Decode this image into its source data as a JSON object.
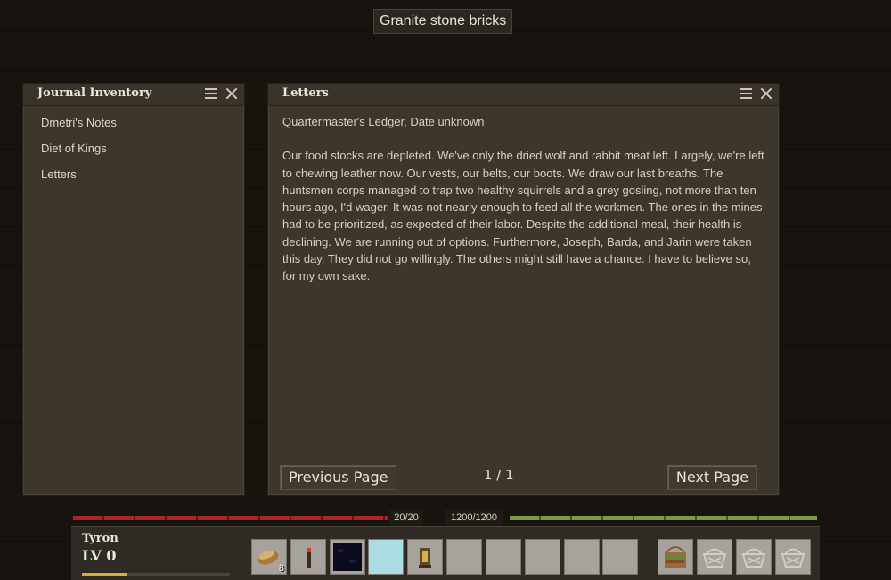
{
  "tooltip": "Granite stone bricks",
  "journal_panel": {
    "title": "Journal Inventory",
    "items": [
      "Dmetri's Notes",
      "Diet of Kings",
      "Letters"
    ]
  },
  "letters_panel": {
    "title": "Letters",
    "heading": "Quartermaster's Ledger, Date unknown",
    "body": "Our food stocks are depleted. We've only the dried wolf and rabbit meat left. Largely, we're left to chewing leather now. Our vests, our belts, our boots. We draw our last breaths. The huntsmen corps managed to trap two healthy squirrels and a grey gosling, not more than ten hours ago, I'd wager. It was not nearly enough to feed all the workmen. The ones in the mines had to be prioritized, as expected of their labor. Despite the additional meal, their health is declining. We are running out of options. Furthermore, Joseph, Barda, and Jarin were taken this day. They did not go willingly. The others might still have a chance. I have to believe so, for my own sake.",
    "prev_label": "Previous Page",
    "next_label": "Next Page",
    "page_indicator": "1 / 1"
  },
  "stats": {
    "health_text": "20/20",
    "health_fraction": 1.0,
    "health_color": "#b3221f",
    "satiety_text": "1200/1200",
    "satiety_fraction": 1.0,
    "satiety_color": "#7f9a3c"
  },
  "character": {
    "name": "Tyron",
    "level": "LV 0",
    "xp_fraction": 0.3,
    "xp_color": "#d6b22a"
  },
  "hotbar": {
    "slots": [
      {
        "icon": "bread-icon",
        "count": "8"
      },
      {
        "icon": "torch-icon",
        "count": ""
      },
      {
        "icon": "obsidian-block-icon",
        "count": ""
      },
      {
        "icon": "empty-slot",
        "count": "",
        "active": true
      },
      {
        "icon": "lantern-icon",
        "count": ""
      },
      {
        "icon": "empty-slot",
        "count": ""
      },
      {
        "icon": "empty-slot",
        "count": ""
      },
      {
        "icon": "empty-slot",
        "count": ""
      },
      {
        "icon": "empty-slot",
        "count": ""
      },
      {
        "icon": "empty-slot",
        "count": ""
      }
    ],
    "bag_slots": [
      "basket-filled-icon",
      "basket-empty-icon",
      "basket-empty-icon",
      "basket-empty-icon"
    ]
  }
}
